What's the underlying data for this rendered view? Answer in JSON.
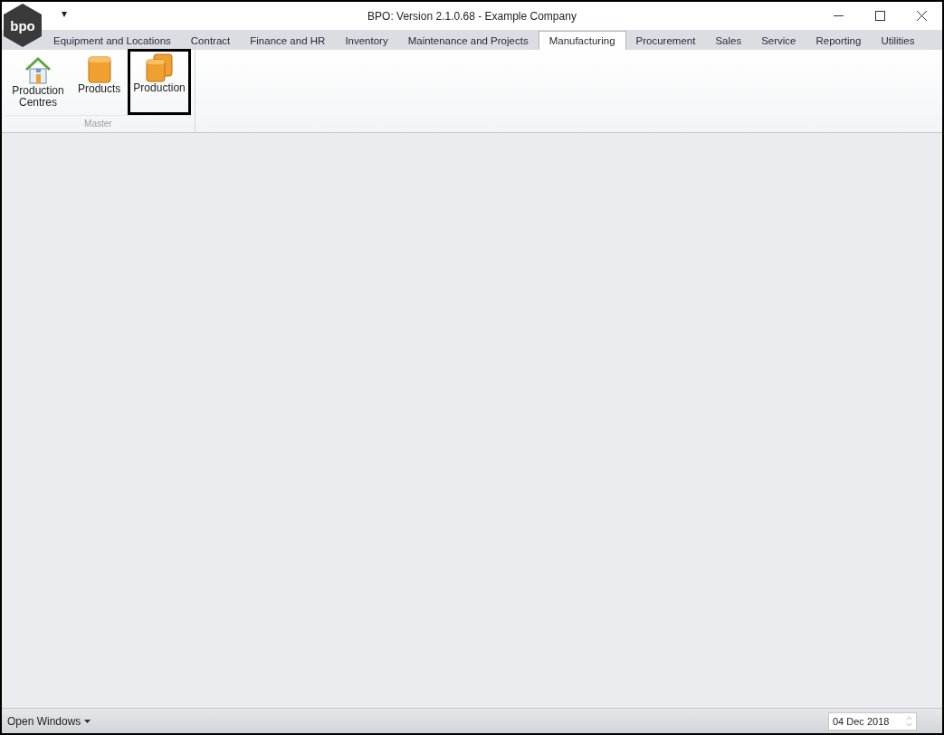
{
  "window": {
    "title": "BPO: Version 2.1.0.68 - Example Company",
    "logo": "bpo",
    "quick_access": "▾"
  },
  "tabs": [
    {
      "label": "Equipment and Locations",
      "selected": false
    },
    {
      "label": "Contract",
      "selected": false
    },
    {
      "label": "Finance and HR",
      "selected": false
    },
    {
      "label": "Inventory",
      "selected": false
    },
    {
      "label": "Maintenance and Projects",
      "selected": false
    },
    {
      "label": "Manufacturing",
      "selected": true
    },
    {
      "label": "Procurement",
      "selected": false
    },
    {
      "label": "Sales",
      "selected": false
    },
    {
      "label": "Service",
      "selected": false
    },
    {
      "label": "Reporting",
      "selected": false
    },
    {
      "label": "Utilities",
      "selected": false
    }
  ],
  "ribbon": {
    "groups": [
      {
        "label": "Master",
        "buttons": [
          {
            "label": "Production Centres",
            "kind": "house",
            "highlighted": false
          },
          {
            "label": "Products",
            "kind": "box",
            "highlighted": false
          },
          {
            "label": "Production",
            "kind": "boxes",
            "highlighted": true
          }
        ]
      }
    ]
  },
  "status_bar": {
    "open_windows": "Open Windows",
    "date": "04 Dec 2018"
  }
}
